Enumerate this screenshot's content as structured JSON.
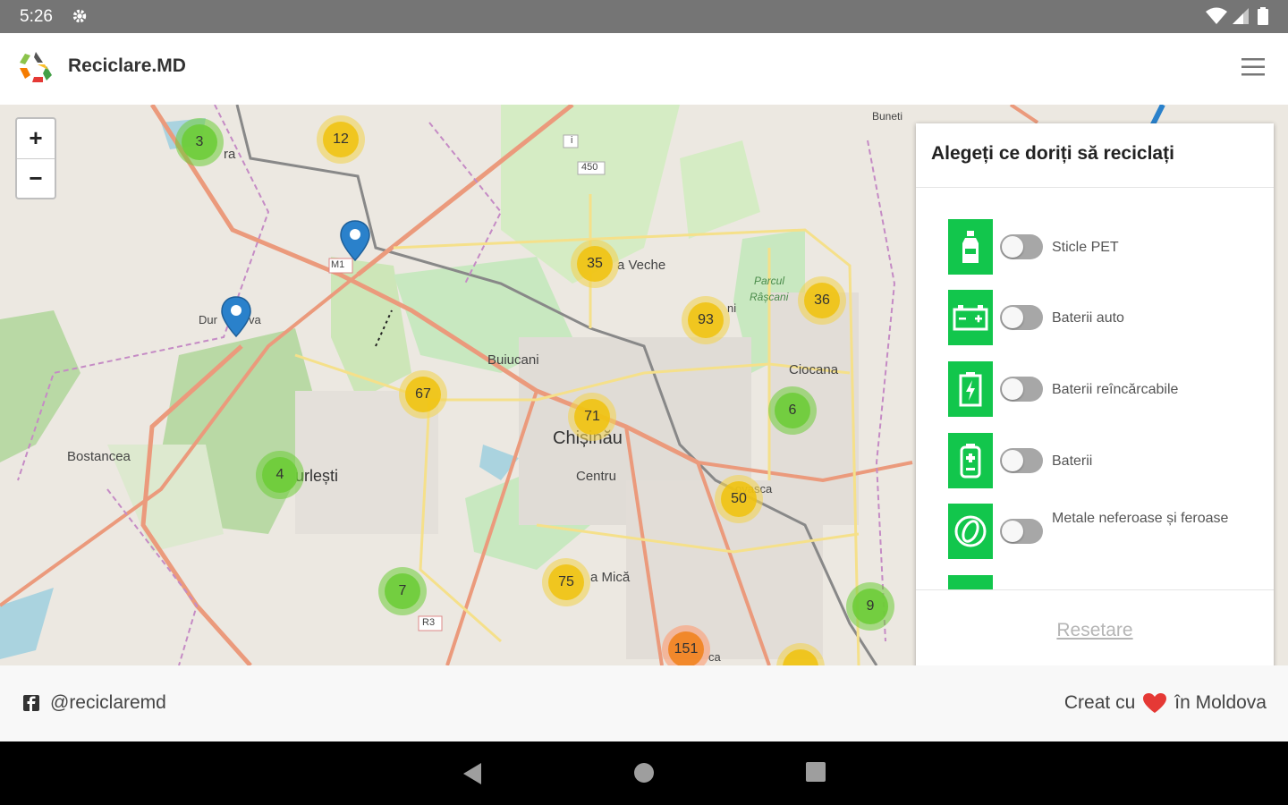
{
  "statusbar": {
    "time": "5:26"
  },
  "appbar": {
    "title": "Reciclare.MD"
  },
  "map": {
    "zoom_in": "+",
    "zoom_out": "−",
    "labels": {
      "ciocana": "Ciocana",
      "buiucani": "Buiucani",
      "chisinau": "Chișinău",
      "centru": "Centru",
      "bostancea": "Bostancea",
      "durlesti": "urlești",
      "veche": "a Veche",
      "mica": "a Mică",
      "vasca": "ovasca",
      "buneti": "Buneti",
      "parcul1": "Parcul",
      "parcul2": "Râșcani",
      "m1": "M1",
      "r3": "R3",
      "l450": "450",
      "dur": "Dur",
      "va": "va",
      "ra": "ra",
      "ni": "ni",
      "ca": "ca",
      "i": "i"
    },
    "clusters": [
      "3",
      "12",
      "35",
      "93",
      "36",
      "67",
      "71",
      "6",
      "4",
      "50",
      "7",
      "75",
      "9",
      "151"
    ]
  },
  "panel": {
    "title": "Alegeți ce doriți să reciclați",
    "items": [
      {
        "label": "Sticle PET",
        "icon": "bottle-icon",
        "enabled": false
      },
      {
        "label": "Baterii auto",
        "icon": "car-battery-icon",
        "enabled": false
      },
      {
        "label": "Baterii reîncărcabile",
        "icon": "rechargeable-battery-icon",
        "enabled": false
      },
      {
        "label": "Baterii",
        "icon": "battery-icon",
        "enabled": false
      },
      {
        "label": "Metale neferoase și feroase",
        "icon": "metal-icon",
        "enabled": false
      }
    ],
    "reset": "Resetare"
  },
  "footer": {
    "handle": "@reciclaremd",
    "made_prefix": "Creat cu",
    "made_suffix": "în Moldova"
  },
  "colors": {
    "accent": "#12c64c",
    "pin": "#2a81cb"
  }
}
